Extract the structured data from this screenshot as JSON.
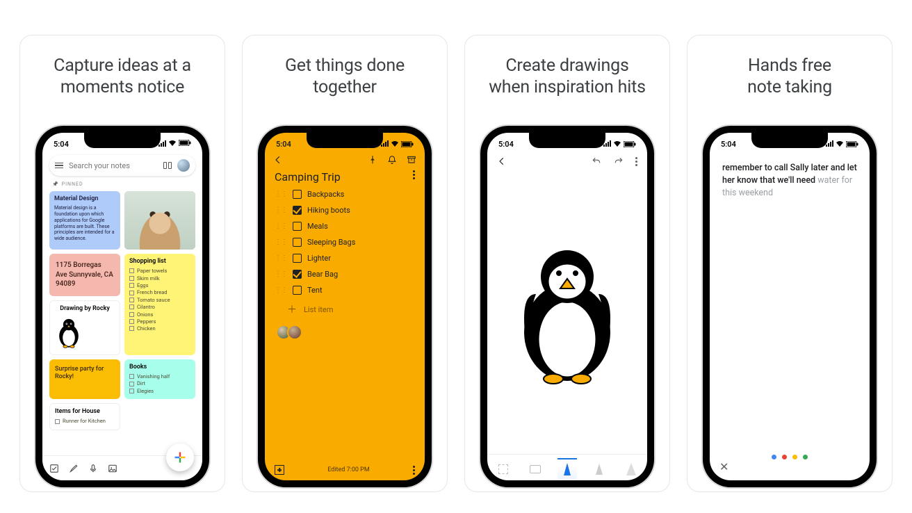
{
  "status_time": "5:04",
  "panels": [
    {
      "title": "Capture ideas at a\nmoments notice"
    },
    {
      "title": "Get things done\ntogether"
    },
    {
      "title": "Create drawings\nwhen inspiration hits"
    },
    {
      "title": "Hands free\nnote taking"
    }
  ],
  "p1": {
    "search_placeholder": "Search your notes",
    "pinned_label": "PINNED",
    "material_title": "Material Design",
    "material_body": "Material design is a foundation upon which applications for Google platforms are built. These principles are intended for a wide audience.",
    "address": "1175 Borregas Ave Sunnyvale, CA 94089",
    "shopping_title": "Shopping list",
    "shopping_items": [
      "Paper towels",
      "Skim milk",
      "Eggs",
      "French bread",
      "Tomato sauce",
      "Cilantro",
      "Onions",
      "Peppers",
      "Chicken"
    ],
    "drawing_title": "Drawing by Rocky",
    "surprise": "Surprise party for Rocky!",
    "books_title": "Books",
    "books_items": [
      "Vanishing half",
      "Dirt",
      "Elegies"
    ],
    "house_title": "Items for House",
    "house_items": [
      "Runner for Kitchen"
    ]
  },
  "p2": {
    "title": "Camping Trip",
    "items": [
      {
        "label": "Backpacks",
        "checked": false
      },
      {
        "label": "Hiking boots",
        "checked": true
      },
      {
        "label": "Meals",
        "checked": false
      },
      {
        "label": "Sleeping Bags",
        "checked": false
      },
      {
        "label": "Lighter",
        "checked": false
      },
      {
        "label": "Bear Bag",
        "checked": true
      },
      {
        "label": "Tent",
        "checked": false
      }
    ],
    "add_label": "List item",
    "edited": "Edited 7:00 PM"
  },
  "p4": {
    "text_strong": "remember to call Sally later and let her know that we'll need",
    "text_faded": " water for this weekend"
  }
}
